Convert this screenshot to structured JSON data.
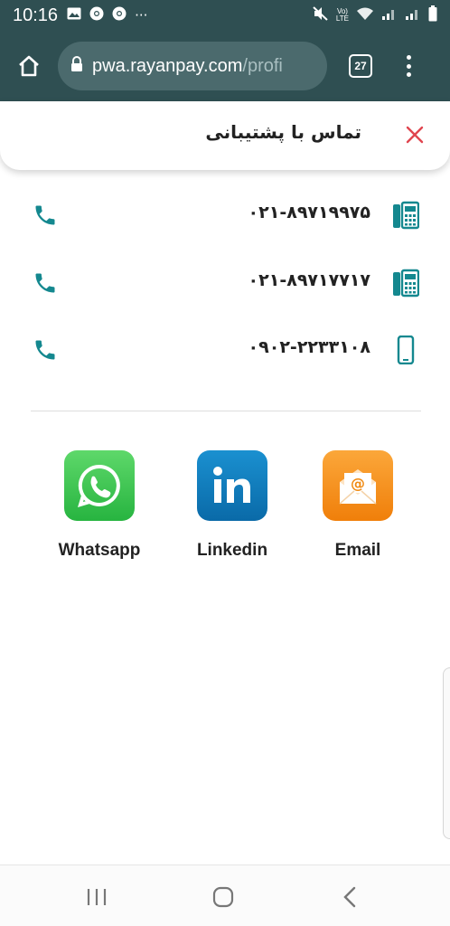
{
  "status_bar": {
    "time": "10:16",
    "left_icons": [
      "image-icon",
      "chrome-icon",
      "chrome-icon",
      "more-dots-icon"
    ],
    "more": "···",
    "network_top": "Vo)",
    "network_bottom": "LTE"
  },
  "browser": {
    "url_host": "pwa.rayanpay.com",
    "url_path": "/profi",
    "tab_count": "27"
  },
  "header": {
    "title": "تماس با پشتیبانی"
  },
  "phones": [
    {
      "number": "۰۲۱-۸۹۷۱۹۹۷۵",
      "type": "landline"
    },
    {
      "number": "۰۲۱-۸۹۷۱۷۷۱۷",
      "type": "landline"
    },
    {
      "number": "۰۹۰۲-۲۲۳۳۱۰۸",
      "type": "mobile"
    }
  ],
  "social": [
    {
      "label": "Whatsapp",
      "color": "#34c44e"
    },
    {
      "label": "Linkedin",
      "color": "#0a78b8"
    },
    {
      "label": "Email",
      "color": "#f58a12"
    }
  ],
  "colors": {
    "status_bg": "#2f4f52",
    "accent_teal": "#14888f",
    "close_red": "#e0454f"
  }
}
